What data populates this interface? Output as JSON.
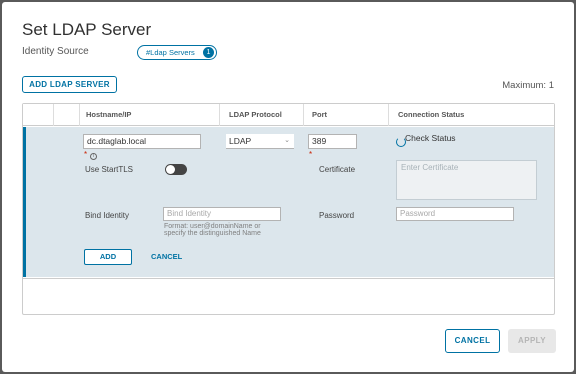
{
  "dialog": {
    "title": "Set LDAP Server",
    "identity_source_label": "Identity Source",
    "identity_source_pill": "#Ldap Servers",
    "identity_source_count": "1",
    "add_ldap_server_label": "ADD LDAP SERVER",
    "maximum_text": "Maximum: 1"
  },
  "grid": {
    "columns": [
      "Hostname/IP",
      "LDAP Protocol",
      "Port",
      "Connection Status"
    ]
  },
  "row": {
    "hostname_value": "dc.dtaglab.local",
    "protocol_value": "LDAP",
    "port_value": "389",
    "check_status_label": "Check Status",
    "required_mark": "*",
    "use_starttls_label": "Use StartTLS",
    "certificate_label": "Certificate",
    "certificate_placeholder": "Enter Certificate",
    "bind_identity_label": "Bind Identity",
    "bind_identity_placeholder": "Bind Identity",
    "bind_identity_hint_1": "Format: user@domainName or",
    "bind_identity_hint_2": "specify the distinguished Name",
    "password_label": "Password",
    "password_placeholder": "Password",
    "add_label": "ADD",
    "cancel_label": "CANCEL"
  },
  "footer": {
    "cancel_label": "CANCEL",
    "apply_label": "APPLY"
  },
  "colors": {
    "accent": "#0072a3",
    "row_bg": "#dce6ec"
  }
}
